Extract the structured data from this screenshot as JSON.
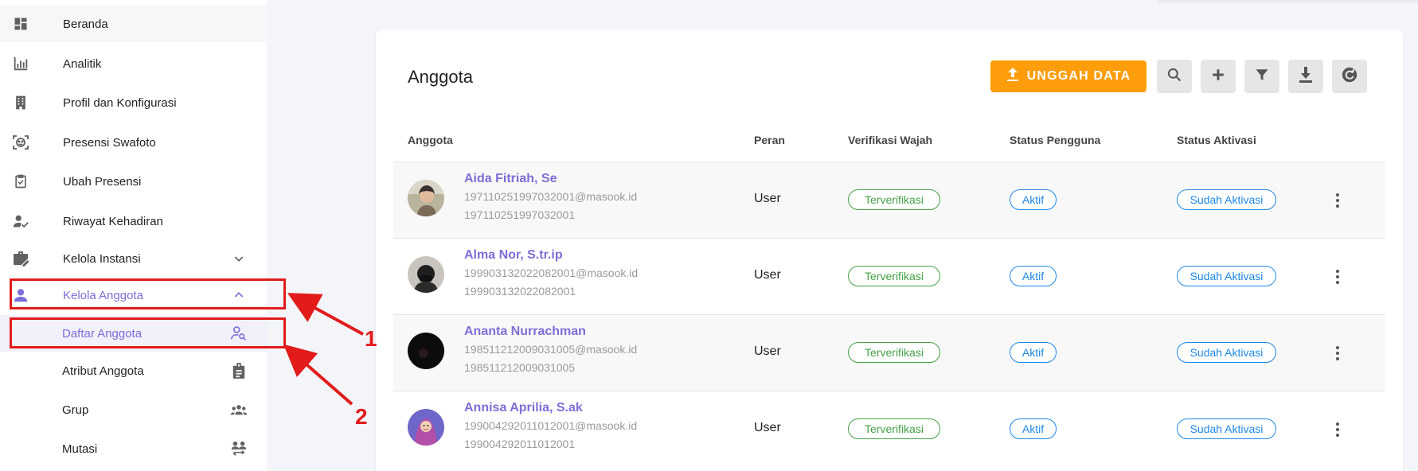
{
  "sidebar": {
    "items": [
      {
        "label": "Beranda",
        "icon": "dashboard-icon"
      },
      {
        "label": "Analitik",
        "icon": "bar-chart-icon"
      },
      {
        "label": "Profil dan Konfigurasi",
        "icon": "building-icon"
      },
      {
        "label": "Presensi Swafoto",
        "icon": "face-scan-icon"
      },
      {
        "label": "Ubah Presensi",
        "icon": "clipboard-check-icon"
      },
      {
        "label": "Riwayat Kehadiran",
        "icon": "person-check-icon"
      },
      {
        "label": "Kelola Instansi",
        "icon": "briefcase-edit-icon",
        "expand": "chevron-down-icon"
      },
      {
        "label": "Kelola Anggota",
        "icon": "person-icon",
        "expand": "chevron-up-icon",
        "state": "expanded"
      },
      {
        "label": "Daftar Anggota",
        "icon": "person-search-icon",
        "state": "selected"
      },
      {
        "label": "Atribut Anggota",
        "icon": "badge-icon"
      },
      {
        "label": "Grup",
        "icon": "group-icon"
      },
      {
        "label": "Mutasi",
        "icon": "swap-people-icon"
      }
    ]
  },
  "card": {
    "title": "Anggota",
    "upload_label": "UNGGAH DATA",
    "tools": [
      "search-icon",
      "add-icon",
      "filter-icon",
      "download-icon",
      "refresh-icon"
    ]
  },
  "table": {
    "headers": [
      "Anggota",
      "Peran",
      "Verifikasi Wajah",
      "Status Pengguna",
      "Status Aktivasi"
    ],
    "rows": [
      {
        "name": "Aida Fitriah, Se",
        "email": "197110251997032001@masook.id",
        "nip": "197110251997032001",
        "role": "User",
        "face": "Terverifikasi",
        "user_status": "Aktif",
        "activation": "Sudah Aktivasi"
      },
      {
        "name": "Alma Nor, S.tr.ip",
        "email": "199903132022082001@masook.id",
        "nip": "199903132022082001",
        "role": "User",
        "face": "Terverifikasi",
        "user_status": "Aktif",
        "activation": "Sudah Aktivasi"
      },
      {
        "name": "Ananta Nurrachman",
        "email": "198511212009031005@masook.id",
        "nip": "198511212009031005",
        "role": "User",
        "face": "Terverifikasi",
        "user_status": "Aktif",
        "activation": "Sudah Aktivasi"
      },
      {
        "name": "Annisa Aprilia, S.ak",
        "email": "199004292011012001@masook.id",
        "nip": "199004292011012001",
        "role": "User",
        "face": "Terverifikasi",
        "user_status": "Aktif",
        "activation": "Sudah Aktivasi"
      }
    ]
  },
  "annotations": {
    "step1": "1",
    "step2": "2"
  },
  "colors": {
    "accent": "#7b6fd6",
    "upload": "#ff9d0b",
    "verified": "#43a047",
    "status": "#1e88e5",
    "annotation": "#e21b1b"
  }
}
